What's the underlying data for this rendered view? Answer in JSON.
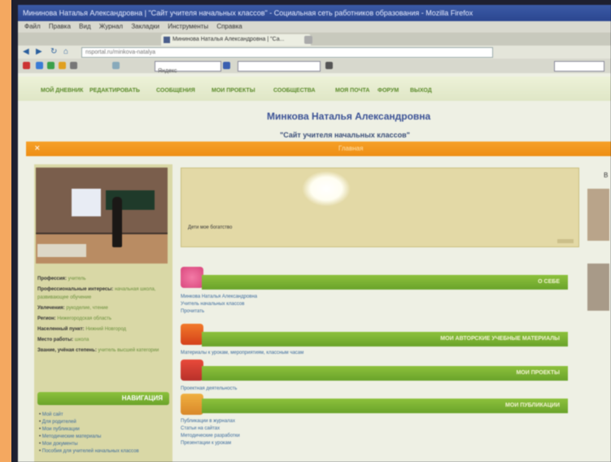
{
  "browser": {
    "window_title": "Мининова Наталья Александровна | \"Сайт учителя начальных классов\" - Социальная сеть работников образования - Mozilla Firefox",
    "menu": [
      "Файл",
      "Правка",
      "Вид",
      "Журнал",
      "Закладки",
      "Инструменты",
      "Справка"
    ],
    "tab_title": "Мининова Наталья Александровна | \"Са...",
    "url": "nsportal.ru/minkova-natalya",
    "search_label": "Яндекс"
  },
  "site": {
    "nav": [
      "МОЙ ДНЕВНИК",
      "РЕДАКТИРОВАТЬ",
      "СООБЩЕНИЯ",
      "МОИ ПРОЕКТЫ",
      "СООБЩЕСТВА",
      "МОЯ ПОЧТА",
      "ФОРУМ",
      "ВЫХОД"
    ],
    "title": "Минкова Наталья Александровна",
    "subtitle": "\"Сайт учителя начальных классов\"",
    "orange_bar": "Главная"
  },
  "profile": {
    "rows": [
      {
        "k": "Профессия:",
        "v": "учитель"
      },
      {
        "k": "Профессиональные интересы:",
        "v": "начальная школа, развивающее обучение"
      },
      {
        "k": "Увлечения:",
        "v": "рукоделие, чтение"
      },
      {
        "k": "Регион:",
        "v": "Нижегородская область"
      },
      {
        "k": "Населенный пункт:",
        "v": "Нижний Новгород"
      },
      {
        "k": "Место работы:",
        "v": "школа"
      },
      {
        "k": "Звание, учёная степень:",
        "v": "учитель высшей категории"
      }
    ]
  },
  "navigation": {
    "heading": "НАВИГАЦИЯ",
    "items": [
      "Мой сайт",
      "Для родителей",
      "Мои публикации",
      "Методические материалы",
      "Мои документы",
      "Пособия для учителей начальных классов"
    ]
  },
  "banner": {
    "caption": "Дети мое богатство"
  },
  "sections": [
    {
      "heading": "О СЕБЕ",
      "lines": [
        "Минкова Наталья Александровна",
        "Учитель начальных классов",
        "Прочитать"
      ]
    },
    {
      "heading": "МОИ АВТОРСКИЕ УЧЕБНЫЕ МАТЕРИАЛЫ",
      "lines": [
        "Материалы к урокам, мероприятиям, классным часам"
      ]
    },
    {
      "heading": "МОИ ПРОЕКТЫ",
      "lines": [
        "Проектная деятельность"
      ]
    },
    {
      "heading": "МОИ ПУБЛИКАЦИИ",
      "lines": [
        "Публикации в журналах",
        "Статьи на сайтах",
        "Методические разработки",
        "Презентации к урокам"
      ]
    }
  ],
  "right": {
    "fragment": "В"
  }
}
